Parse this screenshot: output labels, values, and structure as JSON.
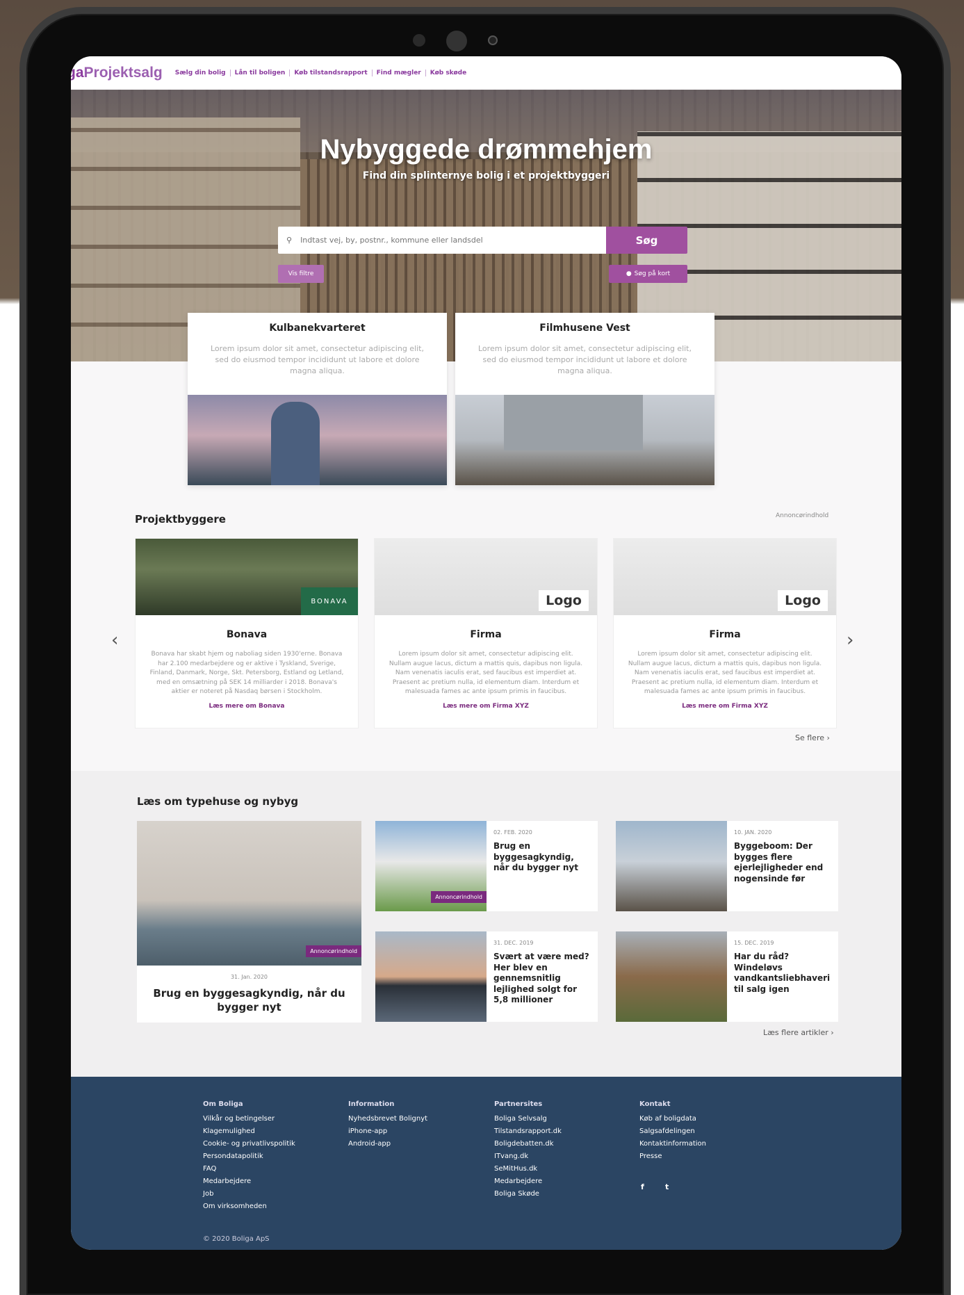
{
  "nav": {
    "logo_prefix": "ga",
    "logo_main": "Projektsalg",
    "links": [
      "Sælg din bolig",
      "Lån til boligen",
      "Køb tilstandsrapport",
      "Find mægler",
      "Køb skøde"
    ]
  },
  "hero": {
    "title": "Nybyggede drømmehjem",
    "subtitle": "Find din splinternye bolig i et projektbyggeri",
    "search_placeholder": "Indtast vej, by, postnr., kommune eller landsdel",
    "search_button": "Søg",
    "filter_button": "Vis filtre",
    "map_button": "Søg på kort"
  },
  "features": [
    {
      "title": "Kulbanekvarteret",
      "text": "Lorem ipsum dolor sit amet, consectetur adipiscing elit, sed do eiusmod tempor incididunt ut labore et dolore magna aliqua."
    },
    {
      "title": "Filmhusene Vest",
      "text": "Lorem ipsum dolor sit amet, consectetur adipiscing elit, sed do eiusmod tempor incididunt ut labore et dolore magna aliqua."
    }
  ],
  "builders": {
    "title": "Projektbyggere",
    "annon": "Annoncørindhold",
    "see_more": "Se flere",
    "items": [
      {
        "name": "Bonava",
        "logo": "BONAVA",
        "text": "Bonava har skabt hjem og naboliag siden 1930'erne. Bonava har 2.100 medarbejdere og er aktive i Tyskland, Sverige, Finland, Danmark, Norge, Skt. Petersborg, Estland og Letland, med en omsætning på SEK 14 milliarder i 2018. Bonava's aktier er noteret på Nasdaq børsen i Stockholm.",
        "link": "Læs mere om Bonava"
      },
      {
        "name": "Firma",
        "logo": "Logo",
        "text": "Lorem ipsum dolor sit amet, consectetur adipiscing elit. Nullam augue lacus, dictum a mattis quis, dapibus non ligula. Nam venenatis iaculis erat, sed faucibus est imperdiet at. Praesent ac pretium nulla, id elementum diam. Interdum et malesuada fames ac ante ipsum primis in faucibus.",
        "link": "Læs mere om Firma XYZ"
      },
      {
        "name": "Firma",
        "logo": "Logo",
        "text": "Lorem ipsum dolor sit amet, consectetur adipiscing elit. Nullam augue lacus, dictum a mattis quis, dapibus non ligula. Nam venenatis iaculis erat, sed faucibus est imperdiet at. Praesent ac pretium nulla, id elementum diam. Interdum et malesuada fames ac ante ipsum primis in faucibus.",
        "link": "Læs mere om Firma XYZ"
      }
    ]
  },
  "articles": {
    "title": "Læs om typehuse og nybyg",
    "more": "Læs flere artikler",
    "featured": {
      "date": "31. Jan. 2020",
      "title": "Brug en byggesagkyndig, når du bygger nyt",
      "badge": "Annoncørindhold"
    },
    "items": [
      {
        "date": "02. FEB. 2020",
        "title": "Brug en byggesagkyndig, når du bygger nyt",
        "badge": "Annoncørindhold"
      },
      {
        "date": "10. JAN. 2020",
        "title": "Byggeboom: Der bygges flere ejerlejligheder end nogensinde før"
      },
      {
        "date": "31. DEC. 2019",
        "title": "Svært at være med? Her blev en gennemsnitlig lejlighed solgt for 5,8 millioner"
      },
      {
        "date": "15. DEC. 2019",
        "title": "Har du råd? Windeløvs vandkantsliebhaveri til salg igen"
      }
    ]
  },
  "footer": {
    "cols": [
      {
        "heading": "Om Boliga",
        "items": [
          "Vilkår og betingelser",
          "Klagemulighed",
          "Cookie- og privatlivspolitik",
          "Persondatapolitik",
          "FAQ",
          "Medarbejdere",
          "Job",
          "Om virksomheden"
        ]
      },
      {
        "heading": "Information",
        "items": [
          "Nyhedsbrevet Bolignyt",
          "iPhone-app",
          "Android-app"
        ]
      },
      {
        "heading": "Partnersites",
        "items": [
          "Boliga Selvsalg",
          "Tilstandsrapport.dk",
          "Boligdebatten.dk",
          "ITvang.dk",
          "SeMitHus.dk",
          "Medarbejdere",
          "Boliga Skøde"
        ]
      },
      {
        "heading": "Kontakt",
        "items": [
          "Køb af boligdata",
          "Salgsafdelingen",
          "Kontaktinformation",
          "Presse"
        ]
      }
    ],
    "social": [
      "f",
      "t"
    ],
    "copyright": "© 2020 Boliga ApS"
  }
}
